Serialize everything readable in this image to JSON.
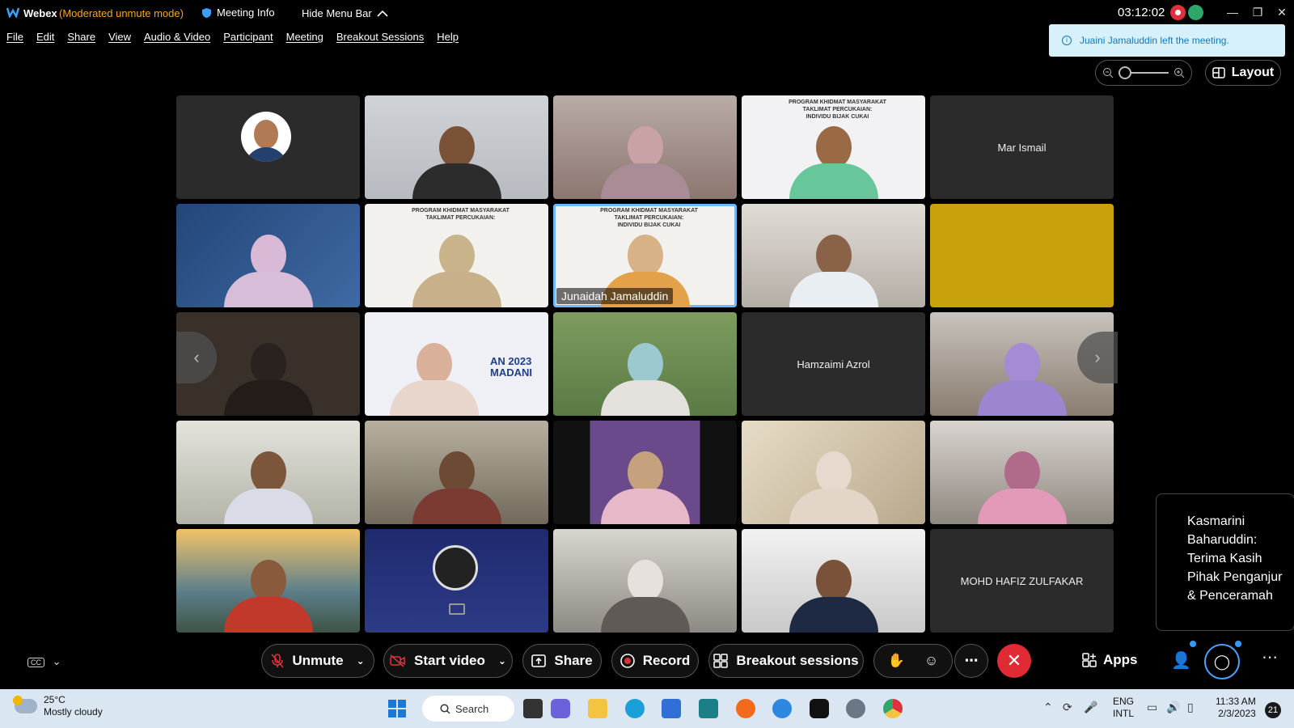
{
  "titlebar": {
    "app_name": "Webex",
    "mode": "(Moderated unmute mode)",
    "meeting_info": "Meeting Info",
    "hide_menu_bar": "Hide Menu Bar",
    "timer": "03:12:02"
  },
  "menu": {
    "items": [
      "File",
      "Edit",
      "Share",
      "View",
      "Audio & Video",
      "Participant",
      "Meeting",
      "Breakout Sessions",
      "Help"
    ]
  },
  "notification": {
    "text": "Juaini Jamaluddin left the meeting."
  },
  "layout_button": {
    "label": "Layout"
  },
  "tiles": [
    {
      "name": "",
      "kind": "avatar"
    },
    {
      "name": "",
      "kind": "video"
    },
    {
      "name": "",
      "kind": "video"
    },
    {
      "name": "",
      "kind": "video"
    },
    {
      "name": "Mar Ismail",
      "kind": "name-only"
    },
    {
      "name": "",
      "kind": "video"
    },
    {
      "name": "",
      "kind": "video"
    },
    {
      "name": "Junaidah Jamaluddin",
      "kind": "video-active"
    },
    {
      "name": "",
      "kind": "video"
    },
    {
      "name": "",
      "kind": "video"
    },
    {
      "name": "",
      "kind": "video"
    },
    {
      "name": "",
      "kind": "video"
    },
    {
      "name": "",
      "kind": "video"
    },
    {
      "name": "Hamzaimi Azrol",
      "kind": "name-only"
    },
    {
      "name": "",
      "kind": "video"
    },
    {
      "name": "",
      "kind": "video"
    },
    {
      "name": "",
      "kind": "video"
    },
    {
      "name": "",
      "kind": "video"
    },
    {
      "name": "",
      "kind": "video"
    },
    {
      "name": "",
      "kind": "video"
    },
    {
      "name": "",
      "kind": "video"
    },
    {
      "name": "",
      "kind": "obs"
    },
    {
      "name": "",
      "kind": "video"
    },
    {
      "name": "",
      "kind": "video"
    },
    {
      "name": "MOHD HAFIZ ZULFAKAR",
      "kind": "name-only"
    }
  ],
  "banner": {
    "line1": "PROGRAM KHIDMAT MASYARAKAT",
    "line2": "TAKLIMAT PERCUKAIAN:",
    "line3": "INDIVIDU BIJAK CUKAI",
    "madani1": "AN 2023",
    "madani2": "MADANI"
  },
  "chat_popup": {
    "text": "Kasmarini Baharuddin: Terima Kasih Pihak Penganjur & Penceramah"
  },
  "controls": {
    "unmute": "Unmute",
    "start_video": "Start video",
    "share": "Share",
    "record": "Record",
    "breakout": "Breakout sessions",
    "apps": "Apps",
    "cc": "CC"
  },
  "taskbar": {
    "temp": "25°C",
    "weather": "Mostly cloudy",
    "search": "Search",
    "lang1": "ENG",
    "lang2": "INTL",
    "time": "11:33 AM",
    "date": "2/3/2023",
    "notif_count": "21"
  },
  "colors": {
    "accent": "#4aa3ff",
    "end_call": "#e02b35",
    "mode_text": "#f5a623",
    "toast_bg": "#d7f1fb"
  }
}
